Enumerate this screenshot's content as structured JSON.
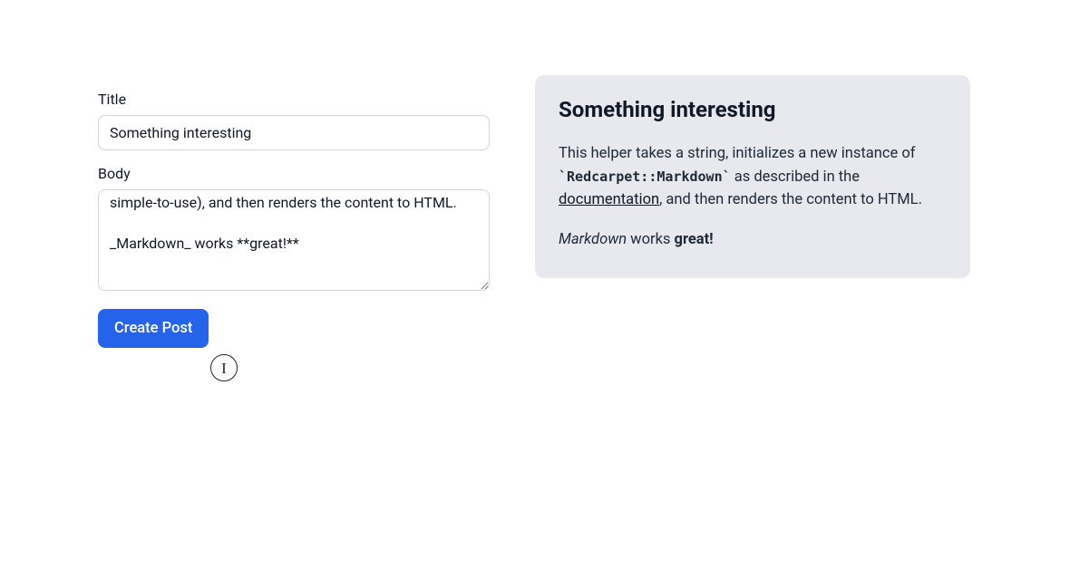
{
  "form": {
    "title_label": "Title",
    "title_value": "Something interesting",
    "body_label": "Body",
    "body_value": "simple-to-use), and then renders the content to HTML.\n\n_Markdown_ works **great!**\n\n",
    "submit_label": "Create Post"
  },
  "preview": {
    "title": "Something interesting",
    "paragraph1_prefix": "This helper takes a string, initializes a new instance of ",
    "paragraph1_code": "`Redcarpet::Markdown`",
    "paragraph1_mid": " as described in the ",
    "paragraph1_link": "documentation",
    "paragraph1_suffix": ", and then renders the content to HTML.",
    "paragraph2_em": "Markdown",
    "paragraph2_mid": " works ",
    "paragraph2_strong": "great!"
  }
}
